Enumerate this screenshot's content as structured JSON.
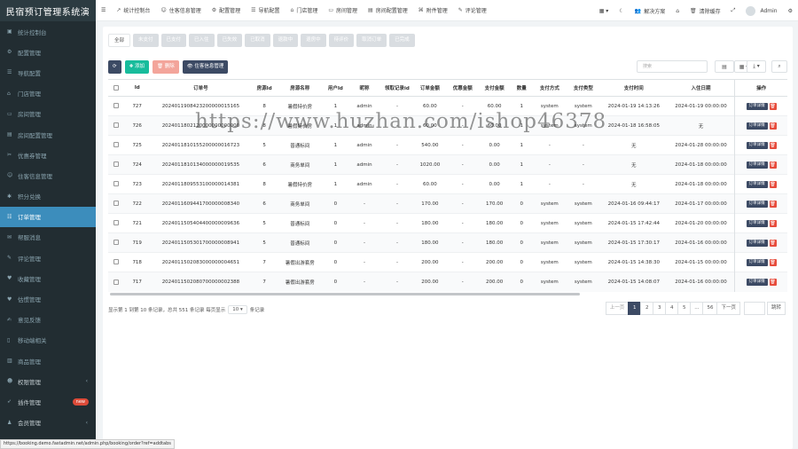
{
  "app_title": "民宿预订管理系统演",
  "sidebar": {
    "items": [
      {
        "label": "统计控制台",
        "icon": "dashboard-icon",
        "type": "item"
      },
      {
        "label": "配置管理",
        "icon": "cog-icon",
        "type": "item"
      },
      {
        "label": "导航配置",
        "icon": "nav-icon",
        "type": "item"
      },
      {
        "label": "门店管理",
        "icon": "store-icon",
        "type": "item"
      },
      {
        "label": "房间管理",
        "icon": "room-icon",
        "type": "item"
      },
      {
        "label": "房间配置管理",
        "icon": "room-config-icon",
        "type": "item"
      },
      {
        "label": "优惠券管理",
        "icon": "coupon-icon",
        "type": "item"
      },
      {
        "label": "住客信息管理",
        "icon": "guest-icon",
        "type": "item"
      },
      {
        "label": "积分兑换",
        "icon": "points-icon",
        "type": "item"
      },
      {
        "label": "订单管理",
        "icon": "order-icon",
        "type": "active"
      },
      {
        "label": "帮服消息",
        "icon": "message-icon",
        "type": "item"
      },
      {
        "label": "评论管理",
        "icon": "comment-icon",
        "type": "item"
      },
      {
        "label": "收藏管理",
        "icon": "heart-icon",
        "type": "item"
      },
      {
        "label": "估惯管理",
        "icon": "heart-icon",
        "type": "item"
      },
      {
        "label": "意见反馈",
        "icon": "feedback-icon",
        "type": "item"
      },
      {
        "label": "移动端相关",
        "icon": "mobile-icon",
        "type": "item"
      },
      {
        "label": "商品管理",
        "icon": "goods-icon",
        "type": "item"
      },
      {
        "label": "权限管理",
        "icon": "users-icon",
        "type": "group"
      },
      {
        "label": "插件管理",
        "icon": "rocket-icon",
        "type": "group",
        "badge": "new"
      },
      {
        "label": "会员管理",
        "icon": "member-icon",
        "type": "group"
      }
    ]
  },
  "topbar": {
    "menu_icon": "☰",
    "items": [
      {
        "icon": "chart-icon",
        "label": "统计控制台"
      },
      {
        "icon": "guest-icon",
        "label": "住客信息管理"
      },
      {
        "icon": "cog-icon",
        "label": "配置管理"
      },
      {
        "icon": "nav-icon",
        "label": "导航配置"
      },
      {
        "icon": "store-icon",
        "label": "门店管理"
      },
      {
        "icon": "room-icon",
        "label": "房间管理"
      },
      {
        "icon": "room-config-icon",
        "label": "房间配置管理"
      },
      {
        "icon": "attachment-icon",
        "label": "附件管理"
      },
      {
        "icon": "comment-icon",
        "label": "评论管理"
      }
    ],
    "right": {
      "solution_label": "解决方案",
      "clear_cache_label": "清除缓存",
      "user_name": "Admin"
    }
  },
  "status_tabs": [
    "全部",
    "未支付",
    "已支付",
    "已入住",
    "已失效",
    "已取消",
    "退款中",
    "退房中",
    "待评价",
    "取消订单",
    "已完成"
  ],
  "toolbar": {
    "refresh_icon": "⟳",
    "add_label": "✚ 添加",
    "delete_label": "🗑 删除",
    "guest_label": "👁 住客信息管理",
    "search_placeholder": "搜索"
  },
  "table": {
    "columns": [
      "Id",
      "订单号",
      "房源Id",
      "房源名称",
      "用户Id",
      "昵称",
      "领取记录id",
      "订单金额",
      "优惠金额",
      "支付金额",
      "数量",
      "支付方式",
      "支付类型",
      "支付时间",
      "入住日期",
      "操作"
    ],
    "rows": [
      [
        "727",
        "2024011908423200000015165",
        "8",
        "暑假特价房",
        "1",
        "admin",
        "-",
        "60.00",
        "-",
        "60.00",
        "1",
        "system",
        "system",
        "2024-01-19 14:13:26",
        "2024-01-19 00:00:00"
      ],
      [
        "726",
        "2024011802120000000000000",
        "8",
        "暑假特价房",
        "1",
        "admin",
        "-",
        "60.00",
        "-",
        "60.00",
        "1",
        "system",
        "system",
        "2024-01-18 16:58:05",
        "无"
      ],
      [
        "725",
        "2024011810155200000016723",
        "5",
        "普通标间",
        "1",
        "admin",
        "-",
        "540.00",
        "-",
        "0.00",
        "1",
        "-",
        "-",
        "无",
        "2024-01-28 00:00:00"
      ],
      [
        "724",
        "2024011810134000000019535",
        "6",
        "商务单间",
        "1",
        "admin",
        "-",
        "1020.00",
        "-",
        "0.00",
        "1",
        "-",
        "-",
        "无",
        "2024-01-18 00:00:00"
      ],
      [
        "723",
        "2024011809553100000014381",
        "8",
        "暑假特价房",
        "1",
        "admin",
        "-",
        "60.00",
        "-",
        "0.00",
        "1",
        "-",
        "-",
        "无",
        "2024-01-18 00:00:00"
      ],
      [
        "722",
        "2024011609441700000008340",
        "6",
        "商务单间",
        "0",
        "-",
        "-",
        "170.00",
        "-",
        "170.00",
        "0",
        "system",
        "system",
        "2024-01-16 09:44:17",
        "2024-01-17 00:00:00"
      ],
      [
        "721",
        "2024011505404400000009636",
        "5",
        "普通标间",
        "0",
        "-",
        "-",
        "180.00",
        "-",
        "180.00",
        "0",
        "system",
        "system",
        "2024-01-15 17:42:44",
        "2024-01-20 00:00:00"
      ],
      [
        "719",
        "2024011505301700000008941",
        "5",
        "普通标间",
        "0",
        "-",
        "-",
        "180.00",
        "-",
        "180.00",
        "0",
        "system",
        "system",
        "2024-01-15 17:30:17",
        "2024-01-16 00:00:00"
      ],
      [
        "718",
        "2024011502083000000004651",
        "7",
        "暑假出游套房",
        "0",
        "-",
        "-",
        "200.00",
        "-",
        "200.00",
        "0",
        "system",
        "system",
        "2024-01-15 14:38:30",
        "2024-01-15 00:00:00"
      ],
      [
        "717",
        "2024011502080700000002388",
        "7",
        "暑假出游套房",
        "0",
        "-",
        "-",
        "200.00",
        "-",
        "200.00",
        "0",
        "system",
        "system",
        "2024-01-15 14:08:07",
        "2024-01-16 00:00:00"
      ]
    ],
    "detail_label": "订单详情",
    "delete_icon": "🗑"
  },
  "footer": {
    "info_prefix": "显示第 1 到第 10 条记录，总共 551 条记录 每页显示",
    "page_size": "10 ▾",
    "info_suffix": "条记录",
    "pages": [
      "上一页",
      "1",
      "2",
      "3",
      "4",
      "5",
      "...",
      "56",
      "下一页"
    ],
    "jump_label": "跳转"
  },
  "status_url": "https://booking.demo.fastadmin.net/admin.php/booking/order?ref=addtabs",
  "watermark": "https://www.huzhan.com/ishop46378"
}
